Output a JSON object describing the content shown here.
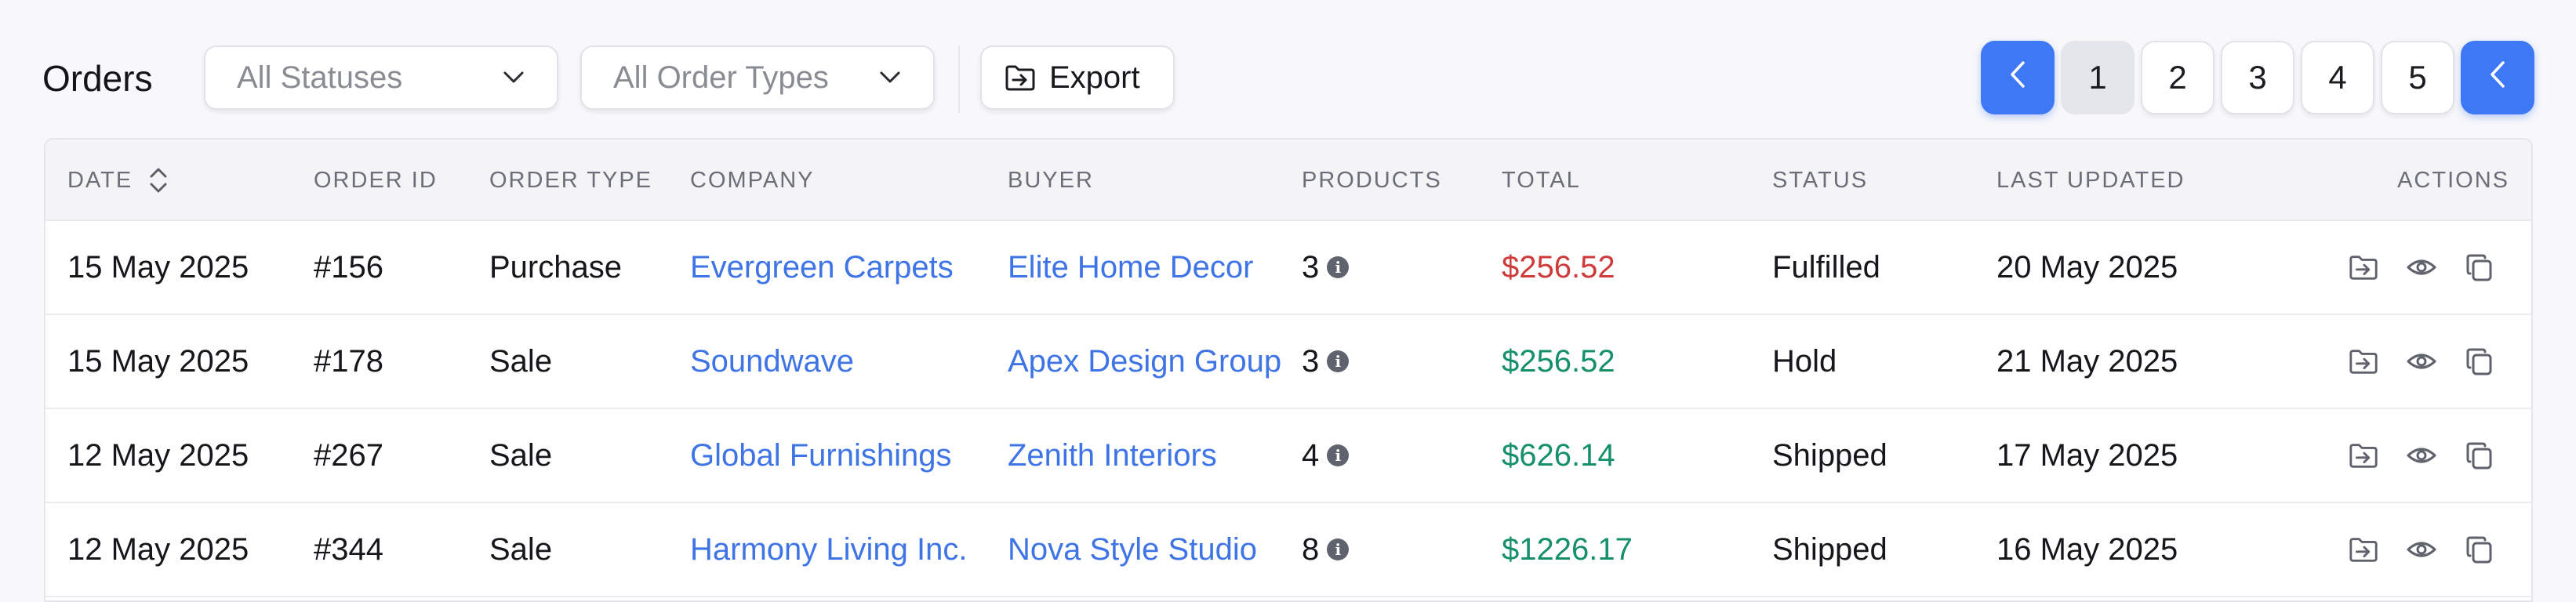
{
  "header": {
    "title": "Orders",
    "status_filter": {
      "value": "All Statuses"
    },
    "type_filter": {
      "value": "All Order Types"
    },
    "export_label": "Export"
  },
  "pagination": {
    "pages": [
      "1",
      "2",
      "3",
      "4",
      "5"
    ],
    "current": "1"
  },
  "table": {
    "columns": [
      "DATE",
      "ORDER ID",
      "ORDER TYPE",
      "COMPANY",
      "BUYER",
      "PRODUCTS",
      "TOTAL",
      "STATUS",
      "LAST UPDATED",
      "ACTIONS"
    ],
    "rows": [
      {
        "date": "15 May 2025",
        "order_id": "#156",
        "order_type": "Purchase",
        "company": "Evergreen Carpets",
        "buyer": "Elite Home Decor",
        "products": "3",
        "total": "$256.52",
        "total_color": "#cf3a3a",
        "status": "Fulfilled",
        "last_updated": "20 May 2025"
      },
      {
        "date": "15 May 2025",
        "order_id": "#178",
        "order_type": "Sale",
        "company": "Soundwave",
        "buyer": "Apex Design Group",
        "products": "3",
        "total": "$256.52",
        "total_color": "#15906a",
        "status": "Hold",
        "last_updated": "21 May 2025"
      },
      {
        "date": "12 May 2025",
        "order_id": "#267",
        "order_type": "Sale",
        "company": "Global Furnishings",
        "buyer": "Zenith Interiors",
        "products": "4",
        "total": "$626.14",
        "total_color": "#15906a",
        "status": "Shipped",
        "last_updated": "17 May 2025"
      },
      {
        "date": "12 May 2025",
        "order_id": "#344",
        "order_type": "Sale",
        "company": "Harmony Living Inc.",
        "buyer": "Nova Style Studio",
        "products": "8",
        "total": "$1226.17",
        "total_color": "#15906a",
        "status": "Shipped",
        "last_updated": "16 May 2025"
      }
    ],
    "row_actions": [
      "export-icon",
      "view-eye-icon",
      "copy-icon"
    ]
  },
  "colors": {
    "accent": "#3f78f5",
    "link": "#3e74e6",
    "negative": "#cf3a3a",
    "positive": "#15906a"
  },
  "icons": {
    "filter_chevron": "chevron-down-icon",
    "export": "export-icon",
    "prev": "chevron-left-icon",
    "next": "chevron-left-icon",
    "sort": "sort-icon",
    "product_info": "info-icon"
  }
}
